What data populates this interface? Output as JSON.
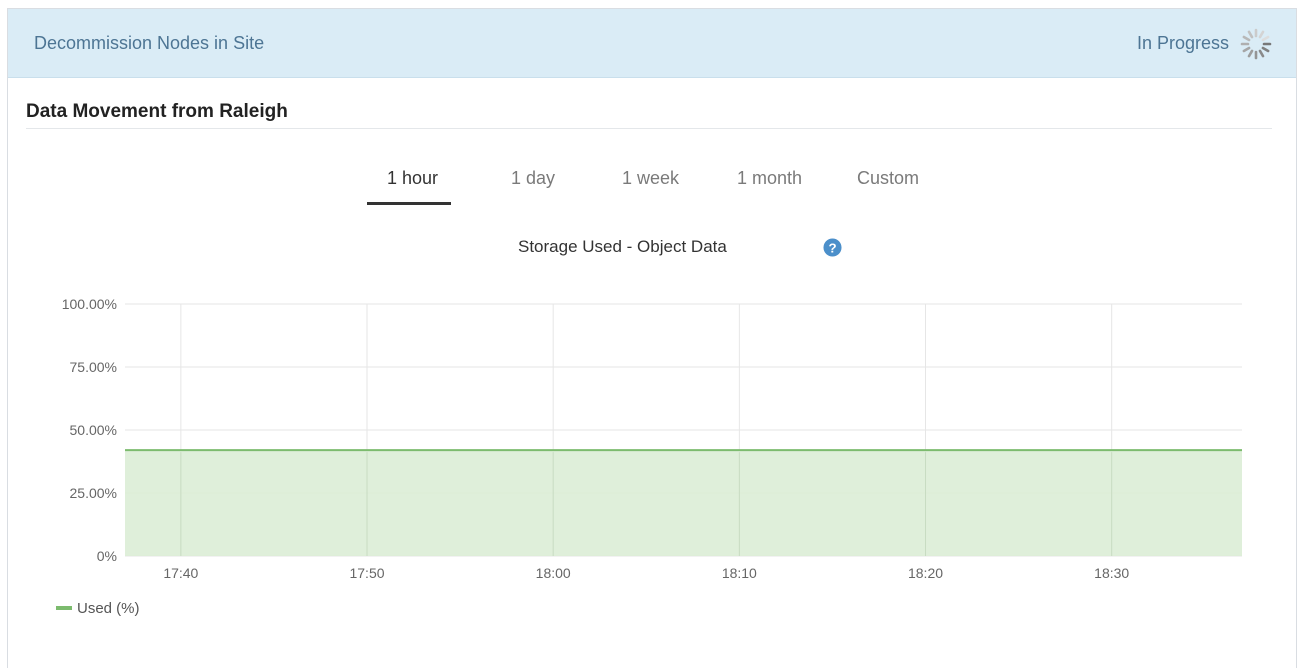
{
  "header": {
    "title": "Decommission Nodes in Site",
    "status": "In Progress"
  },
  "section": {
    "title": "Data Movement from Raleigh"
  },
  "tabs": [
    {
      "label": "1 hour",
      "active": true
    },
    {
      "label": "1 day",
      "active": false
    },
    {
      "label": "1 week",
      "active": false
    },
    {
      "label": "1 month",
      "active": false
    },
    {
      "label": "Custom",
      "active": false
    }
  ],
  "chart_data": {
    "type": "area",
    "title": "Storage Used - Object Data",
    "xlabel": "",
    "ylabel": "",
    "x": [
      "17:37",
      "17:40",
      "17:50",
      "18:00",
      "18:10",
      "18:20",
      "18:30",
      "18:37"
    ],
    "x_ticks": [
      "17:40",
      "17:50",
      "18:00",
      "18:10",
      "18:20",
      "18:30"
    ],
    "y_ticks": [
      "0%",
      "25.00%",
      "50.00%",
      "75.00%",
      "100.00%"
    ],
    "ylim": [
      0,
      100
    ],
    "series": [
      {
        "name": "Used (%)",
        "values": [
          42,
          42,
          42,
          42,
          42,
          42,
          42,
          42
        ],
        "color": "#7cbb6e"
      }
    ],
    "grid": true,
    "legend": "bottom-left"
  },
  "colors": {
    "header_bg": "#daecf6",
    "header_text": "#4d7594",
    "area_fill": "#d9ecd4",
    "area_line": "#7cbb6e",
    "help_icon": "#4b8fca"
  },
  "icons": {
    "spinner": "spinner-icon",
    "help": "question-circle-icon"
  }
}
